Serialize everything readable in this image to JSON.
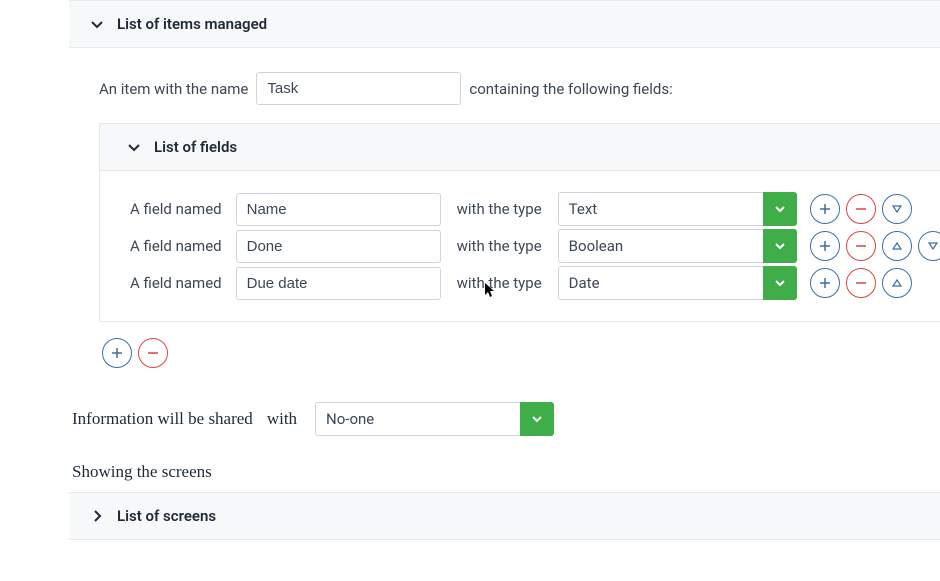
{
  "section1": {
    "title": "List of items managed",
    "item_prefix": "An item with the name",
    "item_name": "Task",
    "item_suffix": "containing the following fields:"
  },
  "fieldsSection": {
    "title": "List of fields",
    "row_prefix": "A field named",
    "row_mid": "with the type",
    "rows": [
      {
        "name": "Name",
        "type": "Text"
      },
      {
        "name": "Done",
        "type": "Boolean"
      },
      {
        "name": "Due date",
        "type": "Date"
      }
    ]
  },
  "share": {
    "prefix": "Information will be shared",
    "with": "with",
    "value": "No-one"
  },
  "screens": {
    "intro": "Showing the screens",
    "title": "List of screens"
  },
  "colors": {
    "green": "#3fae49",
    "blue": "#3b6fa6",
    "red": "#d9463d"
  }
}
